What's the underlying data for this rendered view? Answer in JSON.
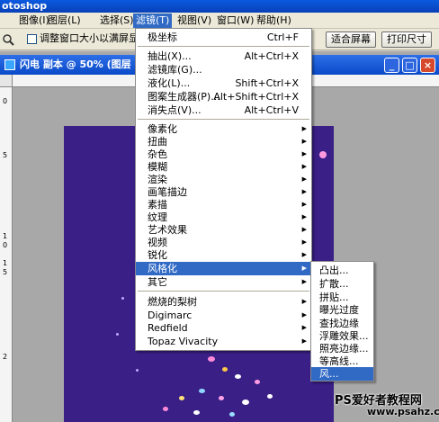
{
  "app": {
    "title": "otoshop"
  },
  "menubar": [
    {
      "label": "图像(I)",
      "active": false
    },
    {
      "label": "图层(L)",
      "active": false
    },
    {
      "label": "选择(S)",
      "active": false
    },
    {
      "label": "滤镜(T)",
      "active": true
    },
    {
      "label": "视图(V)",
      "active": false
    },
    {
      "label": "窗口(W)",
      "active": false
    },
    {
      "label": "帮助(H)",
      "active": false
    }
  ],
  "optionsbar": {
    "resize_window_label": "调整窗口大小以满屏显示",
    "fit_screen_label": "适合屏幕",
    "print_size_label": "打印尺寸"
  },
  "document": {
    "title": "闪电 副本 @ 50% (图层",
    "min_label": "_",
    "max_label": "□",
    "close_label": "×",
    "ruler_v": [
      "0",
      "5",
      "1",
      "0",
      "1",
      "5",
      "2"
    ]
  },
  "filter_menu": {
    "items": [
      {
        "label": "极坐标",
        "shortcut": "Ctrl+F",
        "submenu": false,
        "highlight": false
      },
      {
        "separator": true
      },
      {
        "label": "抽出(X)...",
        "shortcut": "Alt+Ctrl+X",
        "submenu": false,
        "highlight": false
      },
      {
        "label": "滤镜库(G)...",
        "shortcut": "",
        "submenu": false,
        "highlight": false
      },
      {
        "label": "液化(L)...",
        "shortcut": "Shift+Ctrl+X",
        "submenu": false,
        "highlight": false
      },
      {
        "label": "图案生成器(P)...",
        "shortcut": "Alt+Shift+Ctrl+X",
        "submenu": false,
        "highlight": false
      },
      {
        "label": "消失点(V)...",
        "shortcut": "Alt+Ctrl+V",
        "submenu": false,
        "highlight": false
      },
      {
        "separator": true
      },
      {
        "label": "像素化",
        "shortcut": "",
        "submenu": true,
        "highlight": false
      },
      {
        "label": "扭曲",
        "shortcut": "",
        "submenu": true,
        "highlight": false
      },
      {
        "label": "杂色",
        "shortcut": "",
        "submenu": true,
        "highlight": false
      },
      {
        "label": "模糊",
        "shortcut": "",
        "submenu": true,
        "highlight": false
      },
      {
        "label": "渲染",
        "shortcut": "",
        "submenu": true,
        "highlight": false
      },
      {
        "label": "画笔描边",
        "shortcut": "",
        "submenu": true,
        "highlight": false
      },
      {
        "label": "素描",
        "shortcut": "",
        "submenu": true,
        "highlight": false
      },
      {
        "label": "纹理",
        "shortcut": "",
        "submenu": true,
        "highlight": false
      },
      {
        "label": "艺术效果",
        "shortcut": "",
        "submenu": true,
        "highlight": false
      },
      {
        "label": "视频",
        "shortcut": "",
        "submenu": true,
        "highlight": false
      },
      {
        "label": "锐化",
        "shortcut": "",
        "submenu": true,
        "highlight": false
      },
      {
        "label": "风格化",
        "shortcut": "",
        "submenu": true,
        "highlight": true
      },
      {
        "label": "其它",
        "shortcut": "",
        "submenu": true,
        "highlight": false
      },
      {
        "separator": true
      },
      {
        "label": "燃烧的梨树",
        "shortcut": "",
        "submenu": true,
        "highlight": false
      },
      {
        "label": "Digimarc",
        "shortcut": "",
        "submenu": true,
        "highlight": false
      },
      {
        "label": "Redfield",
        "shortcut": "",
        "submenu": true,
        "highlight": false
      },
      {
        "label": "Topaz Vivacity",
        "shortcut": "",
        "submenu": true,
        "highlight": false
      }
    ]
  },
  "stylize_submenu": {
    "items": [
      {
        "label": "凸出...",
        "highlight": false
      },
      {
        "label": "扩散...",
        "highlight": false
      },
      {
        "label": "拼贴...",
        "highlight": false
      },
      {
        "label": "曝光过度",
        "highlight": false
      },
      {
        "label": "查找边缘",
        "highlight": false
      },
      {
        "label": "浮雕效果...",
        "highlight": false
      },
      {
        "label": "照亮边缘...",
        "highlight": false
      },
      {
        "label": "等高线...",
        "highlight": false
      },
      {
        "label": "风...",
        "highlight": true
      }
    ]
  },
  "watermark": {
    "line1": "PS爱好者教程网",
    "line2": "www.psahz.com"
  },
  "colors": {
    "canvas": "#3a1f87",
    "highlight": "#316ac5"
  }
}
